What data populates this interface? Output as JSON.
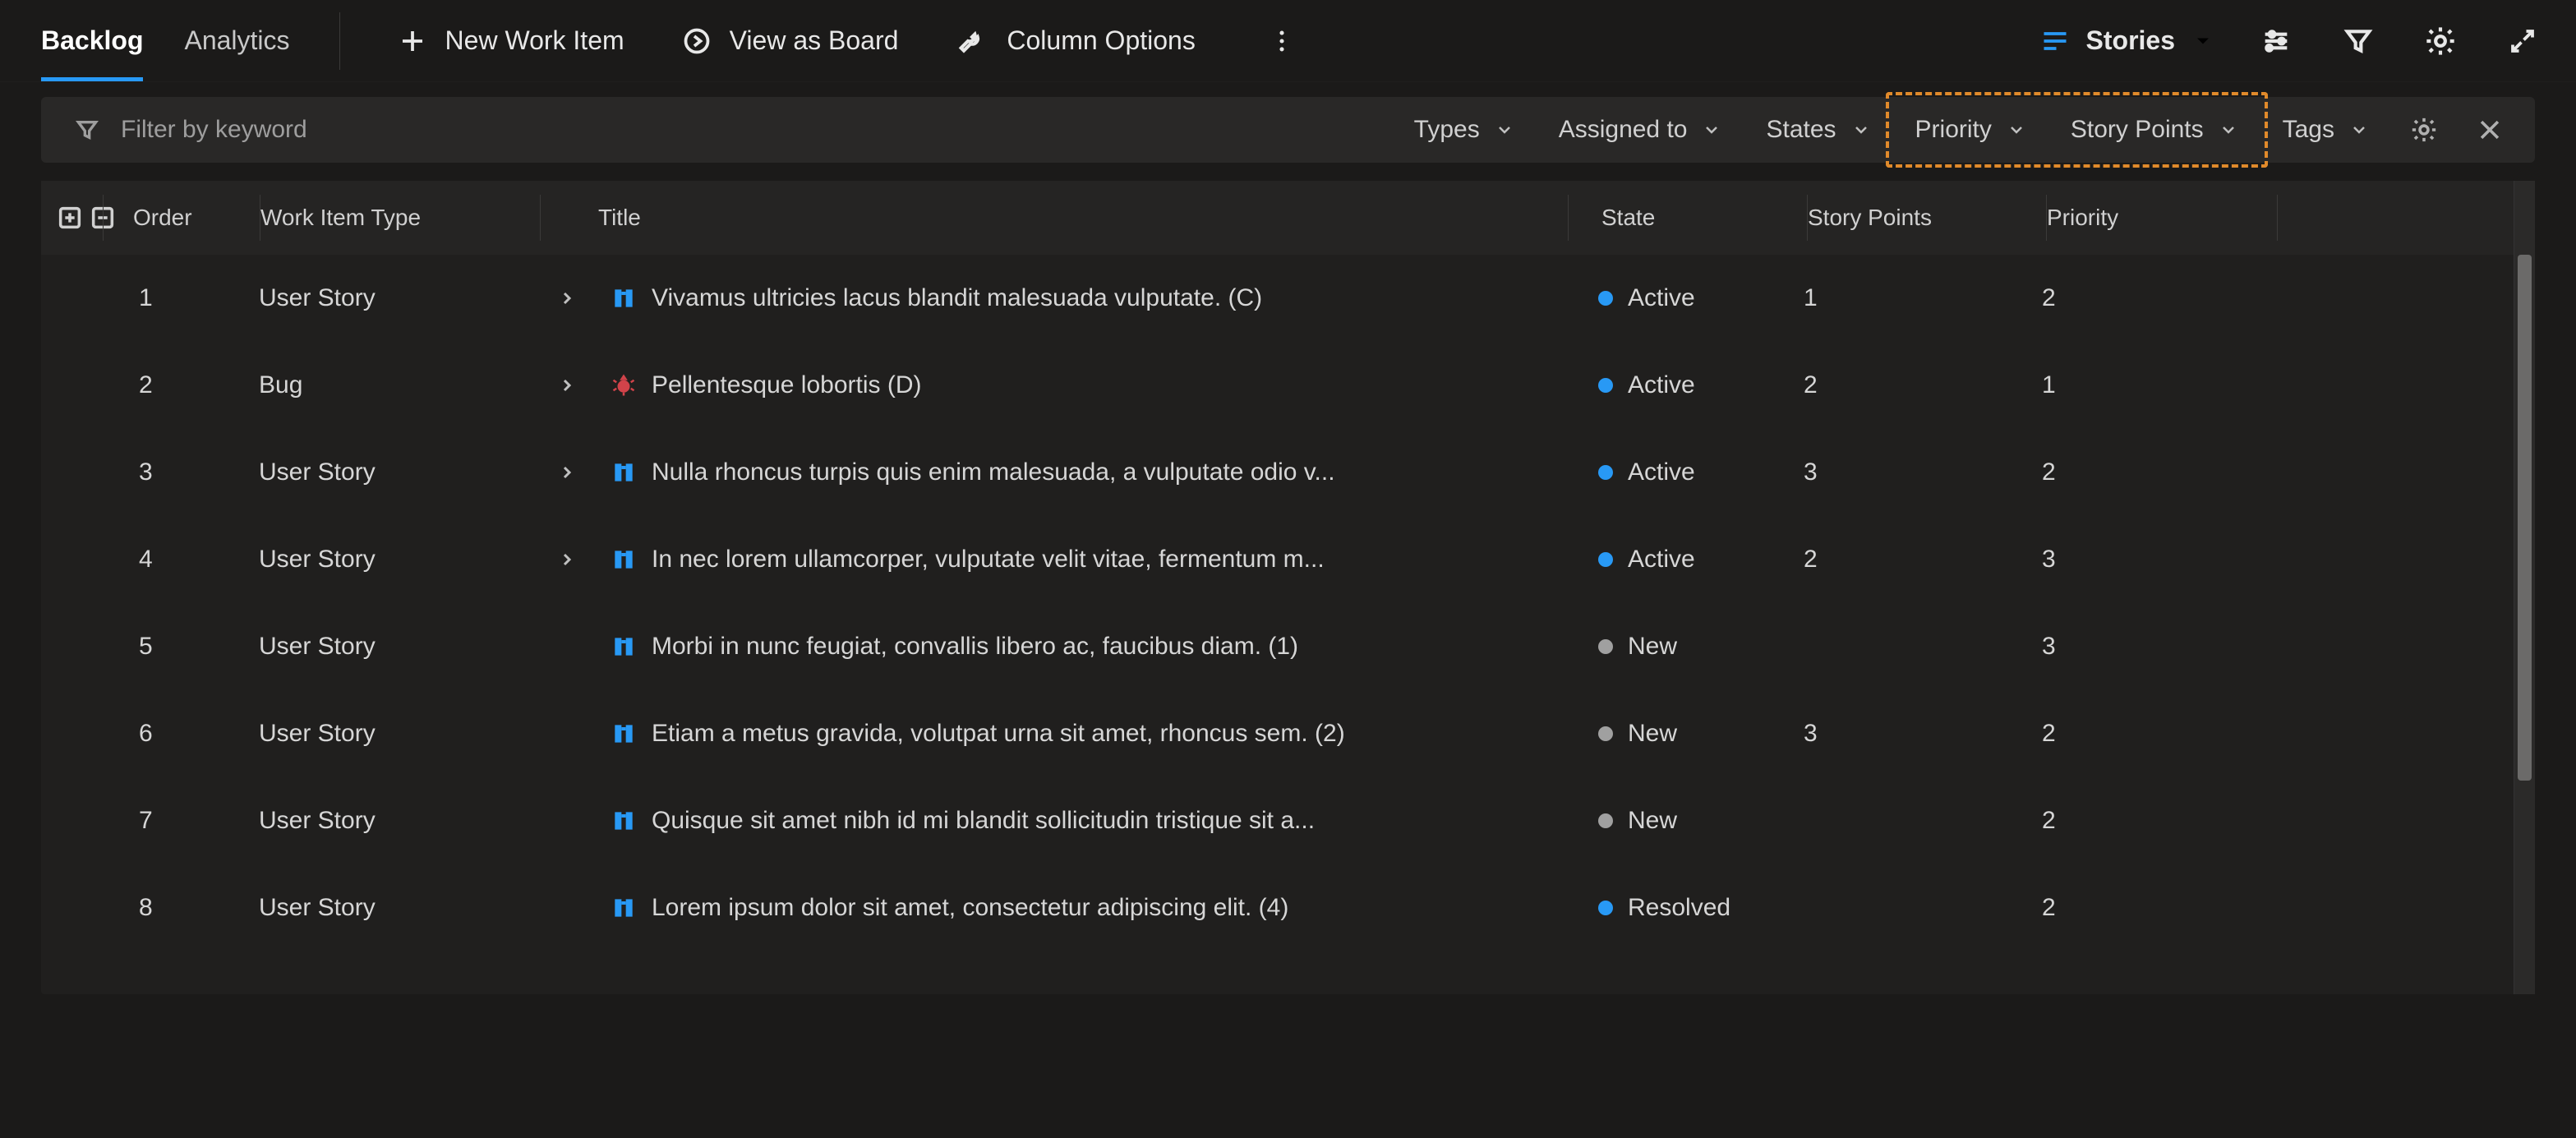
{
  "toolbar": {
    "tabs": {
      "backlog": "Backlog",
      "analytics": "Analytics"
    },
    "new_work_item": "New Work Item",
    "view_as_board": "View as Board",
    "column_options": "Column Options",
    "level": "Stories"
  },
  "filter": {
    "placeholder": "Filter by keyword",
    "types": "Types",
    "assigned_to": "Assigned to",
    "states": "States",
    "priority": "Priority",
    "story_points": "Story Points",
    "tags": "Tags"
  },
  "columns": {
    "order": "Order",
    "work_item_type": "Work Item Type",
    "title": "Title",
    "state": "State",
    "story_points": "Story Points",
    "priority": "Priority"
  },
  "state_colors": {
    "Active": "#2899f5",
    "New": "#a0a0a0",
    "Resolved": "#2899f5"
  },
  "rows": [
    {
      "order": "1",
      "type": "User Story",
      "icon": "story",
      "expandable": true,
      "title": "Vivamus ultricies lacus blandit malesuada vulputate. (C)",
      "state": "Active",
      "sp": "1",
      "pri": "2"
    },
    {
      "order": "2",
      "type": "Bug",
      "icon": "bug",
      "expandable": true,
      "title": "Pellentesque lobortis (D)",
      "state": "Active",
      "sp": "2",
      "pri": "1"
    },
    {
      "order": "3",
      "type": "User Story",
      "icon": "story",
      "expandable": true,
      "title": "Nulla rhoncus turpis quis enim malesuada, a vulputate odio v...",
      "state": "Active",
      "sp": "3",
      "pri": "2"
    },
    {
      "order": "4",
      "type": "User Story",
      "icon": "story",
      "expandable": true,
      "title": "In nec lorem ullamcorper, vulputate velit vitae, fermentum m...",
      "state": "Active",
      "sp": "2",
      "pri": "3"
    },
    {
      "order": "5",
      "type": "User Story",
      "icon": "story",
      "expandable": false,
      "title": "Morbi in nunc feugiat, convallis libero ac, faucibus diam. (1)",
      "state": "New",
      "sp": "",
      "pri": "3"
    },
    {
      "order": "6",
      "type": "User Story",
      "icon": "story",
      "expandable": false,
      "title": "Etiam a metus gravida, volutpat urna sit amet, rhoncus sem. (2)",
      "state": "New",
      "sp": "3",
      "pri": "2"
    },
    {
      "order": "7",
      "type": "User Story",
      "icon": "story",
      "expandable": false,
      "title": "Quisque sit amet nibh id mi blandit sollicitudin tristique sit a...",
      "state": "New",
      "sp": "",
      "pri": "2"
    },
    {
      "order": "8",
      "type": "User Story",
      "icon": "story",
      "expandable": false,
      "title": "Lorem ipsum dolor sit amet, consectetur adipiscing elit. (4)",
      "state": "Resolved",
      "sp": "",
      "pri": "2"
    }
  ]
}
